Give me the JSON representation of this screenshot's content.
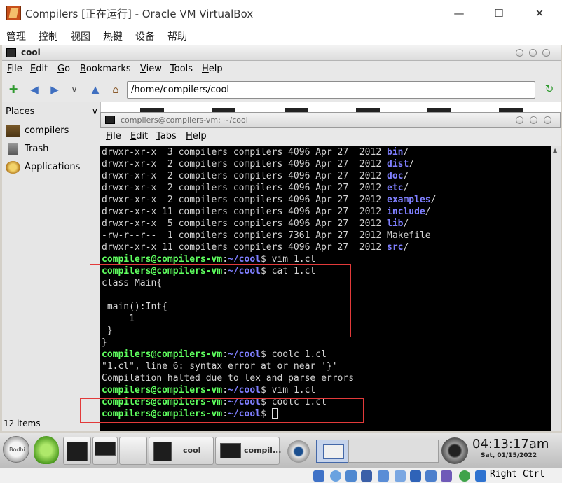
{
  "host": {
    "title": "Compilers [正在运行] - Oracle VM VirtualBox",
    "menu": [
      "管理",
      "控制",
      "视图",
      "热键",
      "设备",
      "帮助"
    ],
    "host_key": "Right Ctrl"
  },
  "file_manager": {
    "title": "cool",
    "menu": [
      {
        "mnemonic": "F",
        "rest": "ile"
      },
      {
        "mnemonic": "E",
        "rest": "dit"
      },
      {
        "mnemonic": "G",
        "rest": "o"
      },
      {
        "mnemonic": "B",
        "rest": "ookmarks"
      },
      {
        "mnemonic": "V",
        "rest": "iew"
      },
      {
        "mnemonic": "T",
        "rest": "ools"
      },
      {
        "mnemonic": "H",
        "rest": "elp"
      }
    ],
    "location": "/home/compilers/cool",
    "places_header": "Places",
    "places": [
      {
        "label": "compilers",
        "icon": "home-folder-icon"
      },
      {
        "label": "Trash",
        "icon": "trash-icon"
      },
      {
        "label": "Applications",
        "icon": "applications-icon"
      }
    ],
    "status": "12 items"
  },
  "terminal": {
    "title": "compilers@compilers-vm: ~/cool",
    "menu": [
      {
        "mnemonic": "F",
        "rest": "ile"
      },
      {
        "mnemonic": "E",
        "rest": "dit"
      },
      {
        "mnemonic": "T",
        "rest": "abs"
      },
      {
        "mnemonic": "H",
        "rest": "elp"
      }
    ],
    "prompt_user": "compilers@compilers-vm",
    "prompt_path": "~/cool",
    "lines": [
      {
        "kind": "ls",
        "text": "drwxr-xr-x  3 compilers compilers 4096 Apr 27  2012 ",
        "name": "bin"
      },
      {
        "kind": "ls",
        "text": "drwxr-xr-x  2 compilers compilers 4096 Apr 27  2012 ",
        "name": "dist"
      },
      {
        "kind": "ls",
        "text": "drwxr-xr-x  2 compilers compilers 4096 Apr 27  2012 ",
        "name": "doc"
      },
      {
        "kind": "ls",
        "text": "drwxr-xr-x  2 compilers compilers 4096 Apr 27  2012 ",
        "name": "etc"
      },
      {
        "kind": "ls",
        "text": "drwxr-xr-x  2 compilers compilers 4096 Apr 27  2012 ",
        "name": "examples"
      },
      {
        "kind": "ls",
        "text": "drwxr-xr-x 11 compilers compilers 4096 Apr 27  2012 ",
        "name": "include"
      },
      {
        "kind": "ls",
        "text": "drwxr-xr-x  5 compilers compilers 4096 Apr 27  2012 ",
        "name": "lib"
      },
      {
        "kind": "plain",
        "text": "-rw-r--r--  1 compilers compilers 7361 Apr 27  2012 Makefile"
      },
      {
        "kind": "ls",
        "text": "drwxr-xr-x 11 compilers compilers 4096 Apr 27  2012 ",
        "name": "src"
      },
      {
        "kind": "cmd",
        "text": "vim 1.cl"
      },
      {
        "kind": "cmd",
        "text": "cat 1.cl"
      },
      {
        "kind": "plain",
        "text": "class Main{"
      },
      {
        "kind": "plain",
        "text": ""
      },
      {
        "kind": "plain",
        "text": " main():Int{"
      },
      {
        "kind": "plain",
        "text": "     1"
      },
      {
        "kind": "plain",
        "text": " }"
      },
      {
        "kind": "plain",
        "text": "}"
      },
      {
        "kind": "cmd",
        "text": "coolc 1.cl"
      },
      {
        "kind": "plain",
        "text": "\"1.cl\", line 6: syntax error at or near '}'"
      },
      {
        "kind": "plain",
        "text": "Compilation halted due to lex and parse errors"
      },
      {
        "kind": "cmd",
        "text": "vim 1.cl"
      },
      {
        "kind": "cmd",
        "text": "coolc 1.cl"
      },
      {
        "kind": "cursor",
        "text": ""
      }
    ]
  },
  "taskbar": {
    "start_label": "Bodhi",
    "tasks": [
      {
        "label": "cool"
      },
      {
        "label": "compil..."
      }
    ],
    "clock": "04:13:17am",
    "date": "Sat, 01/15/2022"
  },
  "colors": {
    "prompt_user": "#5fff5f",
    "prompt_path": "#7f7fff",
    "highlight_box": "#e23a3a",
    "terminal_bg": "#000000"
  }
}
